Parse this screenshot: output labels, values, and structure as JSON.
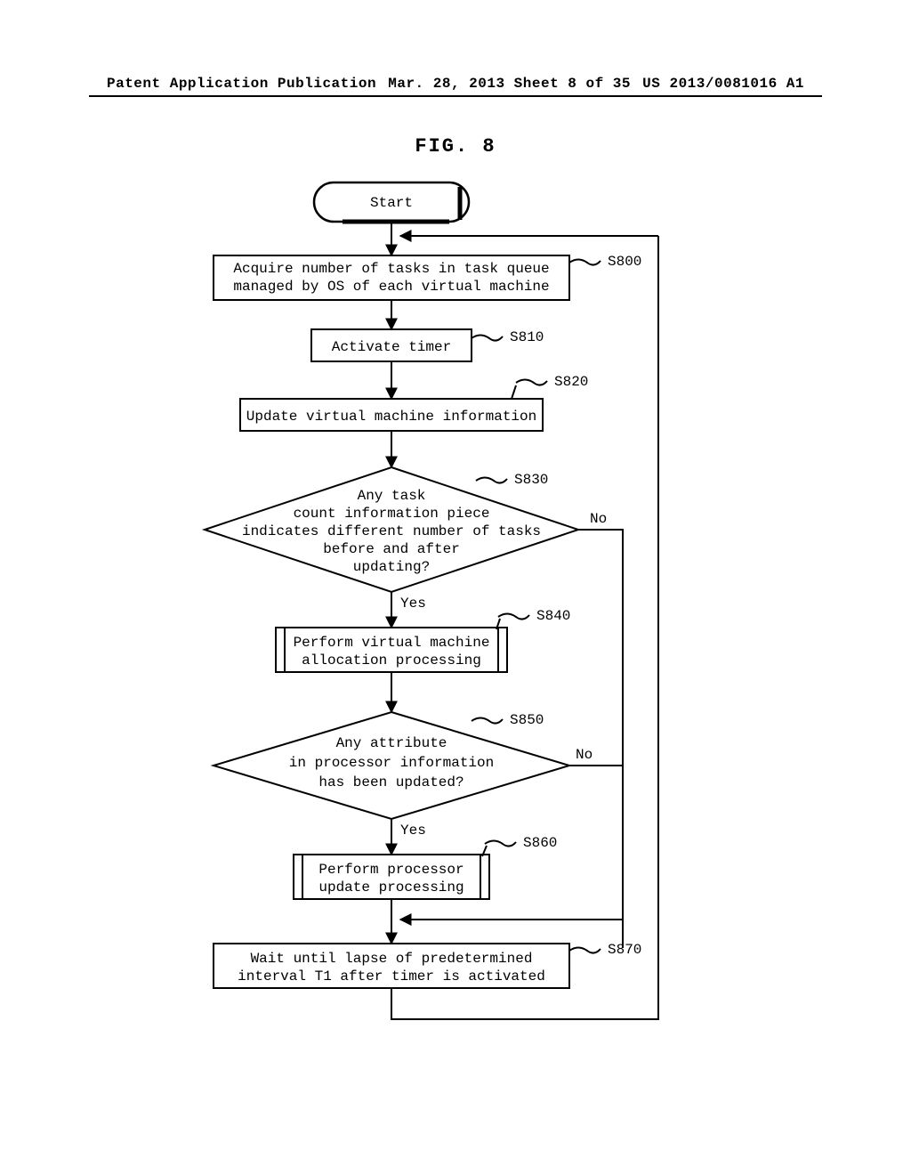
{
  "header": {
    "left": "Patent Application Publication",
    "center": "Mar. 28, 2013  Sheet 8 of 35",
    "right": "US 2013/0081016 A1"
  },
  "figure_title": "FIG. 8",
  "start_label": "Start",
  "steps": {
    "s800": {
      "id": "S800",
      "line1": "Acquire number of tasks in task queue",
      "line2": "managed by OS of each virtual machine"
    },
    "s810": {
      "id": "S810",
      "line1": "Activate timer"
    },
    "s820": {
      "id": "S820",
      "line1": "Update virtual machine information"
    },
    "s830": {
      "id": "S830",
      "l1": "Any task",
      "l2": "count information piece",
      "l3": "indicates different number of tasks",
      "l4": "before and after",
      "l5": "updating?"
    },
    "s840": {
      "id": "S840",
      "line1": "Perform virtual machine",
      "line2": "allocation processing"
    },
    "s850": {
      "id": "S850",
      "l1": "Any attribute",
      "l2": "in processor information",
      "l3": "has been updated?"
    },
    "s860": {
      "id": "S860",
      "line1": "Perform processor",
      "line2": "update processing"
    },
    "s870": {
      "id": "S870",
      "line1": "Wait until lapse of predetermined",
      "line2": "interval T1 after timer is activated"
    }
  },
  "labels": {
    "yes": "Yes",
    "no": "No"
  }
}
